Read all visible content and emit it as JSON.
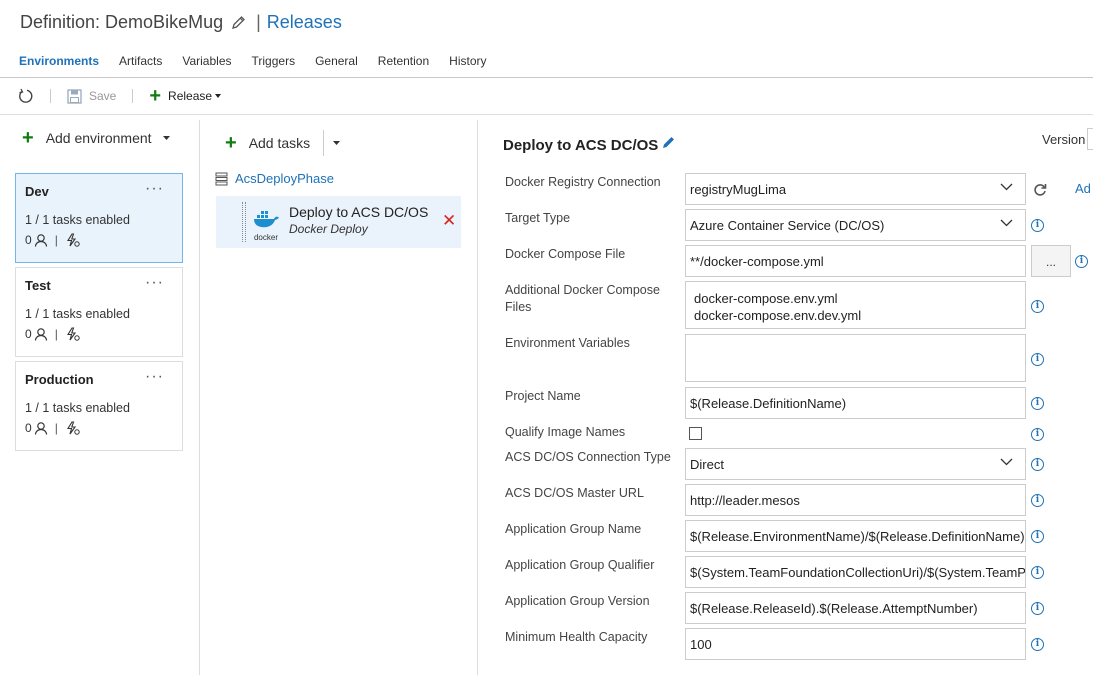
{
  "header": {
    "definition_title": "Definition: DemoBikeMug",
    "releases_link": "Releases"
  },
  "tabs": [
    "Environments",
    "Artifacts",
    "Variables",
    "Triggers",
    "General",
    "Retention",
    "History"
  ],
  "toolbar": {
    "save_label": "Save",
    "release_label": "Release"
  },
  "environments_panel": {
    "add_environment_label": "Add environment",
    "environments": [
      {
        "name": "Dev",
        "tasks": "1 / 1 tasks enabled",
        "approvers": "0",
        "selected": true
      },
      {
        "name": "Test",
        "tasks": "1 / 1 tasks enabled",
        "approvers": "0",
        "selected": false
      },
      {
        "name": "Production",
        "tasks": "1 / 1 tasks enabled",
        "approvers": "0",
        "selected": false
      }
    ]
  },
  "tasks_panel": {
    "add_tasks_label": "Add tasks",
    "phase_name": "AcsDeployPhase",
    "task": {
      "name": "Deploy to ACS DC/OS",
      "subtitle": "Docker Deploy",
      "icon_text": "docker"
    }
  },
  "task_editor": {
    "title": "Deploy to ACS DC/OS",
    "version_label": "Version",
    "add_link": "Ad",
    "browse_label": "...",
    "fields": {
      "registry": {
        "label": "Docker Registry Connection",
        "value": "registryMugLima"
      },
      "target_type": {
        "label": "Target Type",
        "value": "Azure Container Service (DC/OS)"
      },
      "compose_file": {
        "label": "Docker Compose File",
        "value": "**/docker-compose.yml"
      },
      "additional_compose": {
        "label": "Additional Docker Compose Files",
        "line1": "docker-compose.env.yml",
        "line2": "docker-compose.env.dev.yml"
      },
      "env_vars": {
        "label": "Environment Variables",
        "value": ""
      },
      "project_name": {
        "label": "Project Name",
        "value": "$(Release.DefinitionName)"
      },
      "qualify_images": {
        "label": "Qualify Image Names",
        "checked": false
      },
      "connection_type": {
        "label": "ACS DC/OS Connection Type",
        "value": "Direct"
      },
      "master_url": {
        "label": "ACS DC/OS Master URL",
        "value": "http://leader.mesos"
      },
      "app_group_name": {
        "label": "Application Group Name",
        "value": "$(Release.EnvironmentName)/$(Release.DefinitionName)"
      },
      "app_group_qualifier": {
        "label": "Application Group Qualifier",
        "value": "$(System.TeamFoundationCollectionUri)/$(System.TeamProject)"
      },
      "app_group_version": {
        "label": "Application Group Version",
        "value": "$(Release.ReleaseId).$(Release.AttemptNumber)"
      },
      "min_health": {
        "label": "Minimum Health Capacity",
        "value": "100"
      }
    }
  },
  "colors": {
    "accent": "#1e72b8",
    "add_green": "#107c10",
    "delete_red": "#d9261c",
    "selected_bg": "#e9f3fb"
  },
  "icons": [
    "pencil-icon",
    "refresh-icon",
    "save-icon",
    "plus-icon",
    "chevron-down-icon",
    "person-icon",
    "lightning-icon",
    "phase-icon",
    "docker-icon",
    "close-icon",
    "info-icon",
    "reload-icon"
  ]
}
